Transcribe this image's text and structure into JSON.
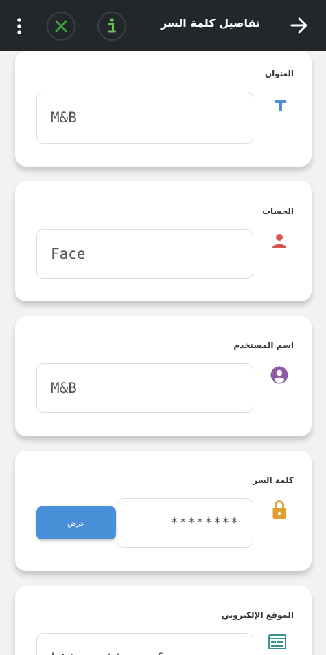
{
  "header": {
    "title": "تفاصيل كلمة السر",
    "back_icon": "arrow-right-icon",
    "info_icon": "info-icon",
    "close_icon": "close-x-icon",
    "menu_icon": "more-vert-icon"
  },
  "fields": {
    "title": {
      "label": "العنوان",
      "value": "M&B",
      "icon": "text-t-icon"
    },
    "account": {
      "label": "الحساب",
      "value": "Face",
      "icon": "person-icon"
    },
    "username": {
      "label": "اسم المستخدم",
      "value": "M&B",
      "icon": "account-circle-icon"
    },
    "password": {
      "label": "كلمة السر",
      "value": "********",
      "show_label": "عرض",
      "icon": "lock-icon"
    },
    "website": {
      "label": "الموقع الإلكتروني",
      "value": "https://www.fac",
      "icon": "web-icon"
    }
  },
  "colors": {
    "appbar": "#22272b",
    "close": "#3aa53a",
    "info": "#6bc24a",
    "title_icon": "#4a90d9",
    "account_icon": "#d9534f",
    "username_icon": "#8e5aa8",
    "lock_icon": "#e0a030",
    "show_button": "#4a90d9"
  }
}
